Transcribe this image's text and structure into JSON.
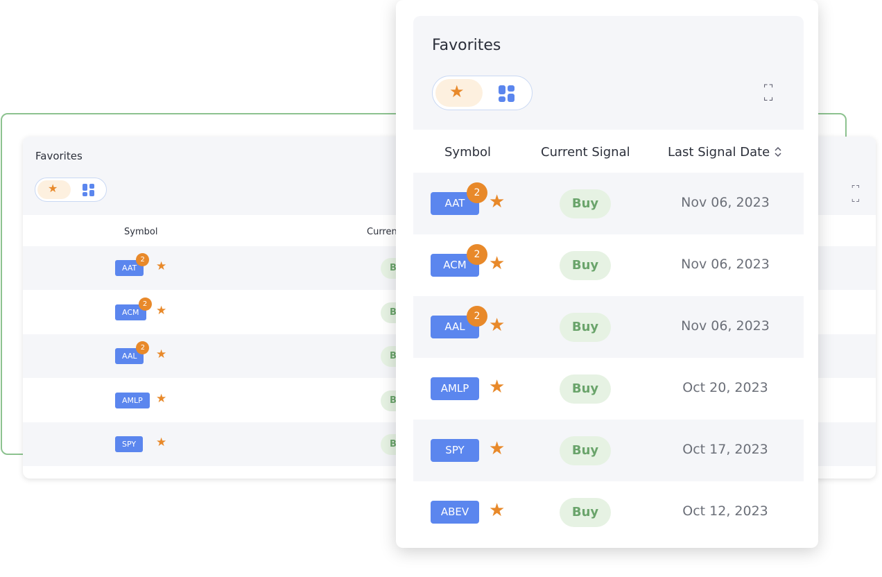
{
  "colors": {
    "accent_blue": "#5b86ee",
    "star_orange": "#e8892a",
    "buy_green": "#6aa46b",
    "frame_green": "#8cc28f"
  },
  "back_card": {
    "title": "Favorites",
    "icons": {
      "favorites_tab": "star-icon",
      "grid_tab": "grid-icon",
      "expand": "expand-icon"
    },
    "columns": {
      "symbol": "Symbol",
      "current_signal_partial": "Curren"
    },
    "rows": [
      {
        "symbol": "AAT",
        "badge": "2",
        "signal_partial": "B"
      },
      {
        "symbol": "ACM",
        "badge": "2",
        "signal_partial": "B"
      },
      {
        "symbol": "AAL",
        "badge": "2",
        "signal_partial": "B"
      },
      {
        "symbol": "AMLP",
        "badge": "",
        "signal_partial": "B"
      },
      {
        "symbol": "SPY",
        "badge": "",
        "signal_partial": "B"
      }
    ]
  },
  "front_card": {
    "title": "Favorites",
    "icons": {
      "favorites_tab": "star-icon",
      "grid_tab": "grid-icon",
      "expand": "expand-icon",
      "sort": "sort-icon"
    },
    "columns": {
      "symbol": "Symbol",
      "current_signal": "Current Signal",
      "last_signal_date": "Last Signal Date"
    },
    "rows": [
      {
        "symbol": "AAT",
        "badge": "2",
        "signal": "Buy",
        "date": "Nov 06, 2023"
      },
      {
        "symbol": "ACM",
        "badge": "2",
        "signal": "Buy",
        "date": "Nov 06, 2023"
      },
      {
        "symbol": "AAL",
        "badge": "2",
        "signal": "Buy",
        "date": "Nov 06, 2023"
      },
      {
        "symbol": "AMLP",
        "badge": "",
        "signal": "Buy",
        "date": "Oct 20, 2023"
      },
      {
        "symbol": "SPY",
        "badge": "",
        "signal": "Buy",
        "date": "Oct 17, 2023"
      },
      {
        "symbol": "ABEV",
        "badge": "",
        "signal": "Buy",
        "date": "Oct 12, 2023"
      }
    ]
  }
}
